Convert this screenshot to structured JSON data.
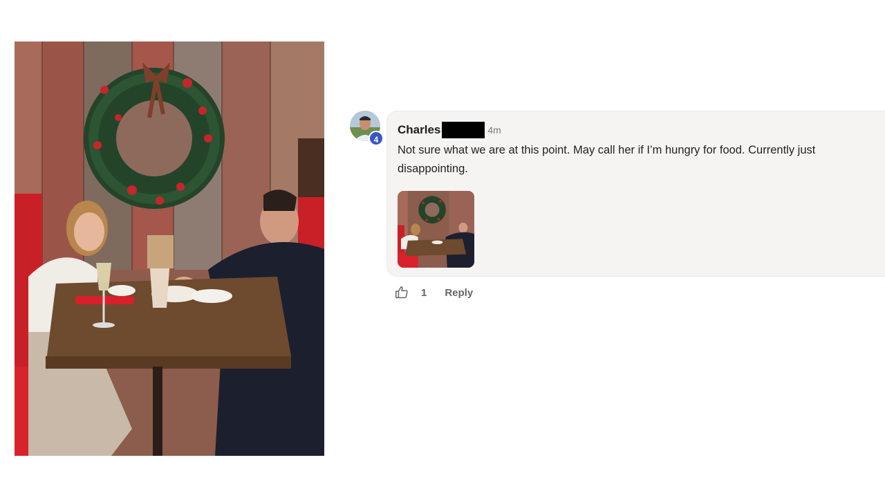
{
  "post": {
    "photo_icon": "restaurant-photo",
    "photo_description_visible": false
  },
  "comment": {
    "author_first_name": "Charles",
    "author_last_name_redacted": true,
    "avatar_badge": "4",
    "timestamp": "4m",
    "text": "Not sure what we are at this point. May call her if I’m hungry for food. Currently just disappointing.",
    "attachment_icon": "attached-photo-thumbnail"
  },
  "actions": {
    "like_icon": "thumbs-up-icon",
    "like_count": "1",
    "reply_label": "Reply"
  },
  "colors": {
    "badge": "#3a55c4",
    "bubble_bg": "#f5f4f3",
    "booth_red": "#d8232a",
    "wood": "#6e4a2e"
  }
}
